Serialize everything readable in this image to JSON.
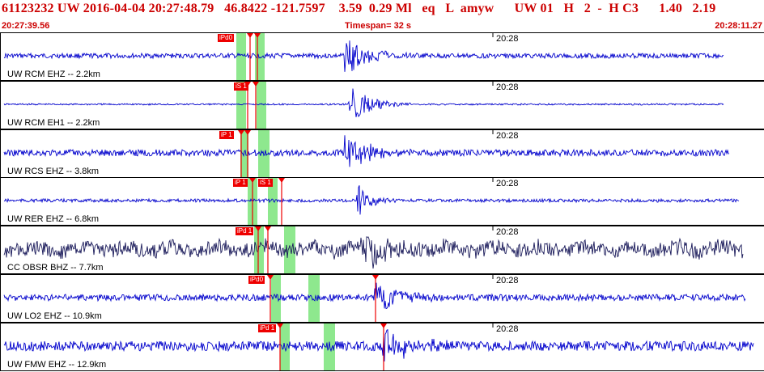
{
  "header": {
    "summary": "61123232 UW 2016-04-04 20:27:48.79   46.8422 -121.7597    3.59  0.29 Ml   eq   L  amyw      UW 01   H   2  -  H C3      1.40   2.19",
    "start_time": "20:27:39.56",
    "timespan": "Timespan=  32 s",
    "end_time": "20:28:11.27"
  },
  "colors": {
    "trace_blue": "#0000cc",
    "trace_dark": "#1a1a5a",
    "pick_red": "#ee0000",
    "window_green": "#8ee88e",
    "text_red": "#cc0000"
  },
  "panels": [
    {
      "station": "UW RCM EHZ -- 2.2km",
      "time_label": "20:28",
      "picks": [
        "iPd0",
        ""
      ],
      "trace_color": "blue"
    },
    {
      "station": "UW RCM EH1 -- 2.2km",
      "time_label": "20:28",
      "picks": [
        "iS 1",
        ""
      ],
      "trace_color": "blue"
    },
    {
      "station": "UW RCS EHZ -- 3.8km",
      "time_label": "20:28",
      "picks": [
        "iP 1",
        ""
      ],
      "trace_color": "blue"
    },
    {
      "station": "UW RER EHZ -- 6.8km",
      "time_label": "20:28",
      "picks": [
        "iP 1",
        "iS 1"
      ],
      "trace_color": "blue"
    },
    {
      "station": "CC OBSR BHZ -- 7.7km",
      "time_label": "20:28",
      "picks": [
        "iPd 1",
        ""
      ],
      "trace_color": "dark"
    },
    {
      "station": "UW LO2 EHZ -- 10.9km",
      "time_label": "20:28",
      "picks": [
        "iPd0",
        ""
      ],
      "trace_color": "blue"
    },
    {
      "station": "UW FMW EHZ -- 12.9km",
      "time_label": "20:28",
      "picks": [
        "iPd 1",
        ""
      ],
      "trace_color": "blue"
    }
  ]
}
